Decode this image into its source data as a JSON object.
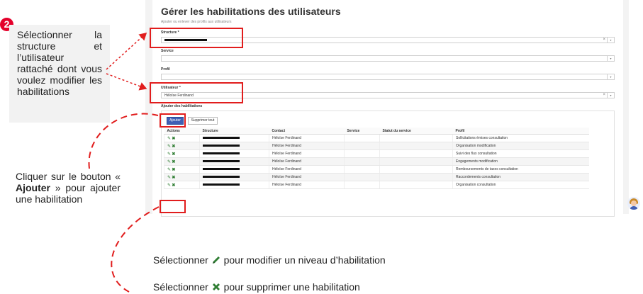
{
  "step_badge": "2",
  "callout_select": "Sélectionner la structure et l’utilisateur rattaché dont vous voulez modifier les habilitations",
  "callout_add_before": "Cliquer sur le bouton « ",
  "callout_add_bold": "Ajouter",
  "callout_add_after": " » pour ajouter une habilitation",
  "legend_edit_before": "Sélectionner",
  "legend_edit_after": "pour modifier un niveau d’habilitation",
  "legend_delete_before": "Sélectionner",
  "legend_delete_after": "pour supprimer une habilitation",
  "form": {
    "title": "Gérer les habilitations des utilisateurs",
    "subtitle": "Ajouter ou enlever des profils aux utilisateurs",
    "structure_label": "Structure *",
    "service_label": "Service",
    "profil_label": "Profil",
    "utilisateur_label": "Utilisateur *",
    "utilisateur_value": "Héloïse Ferdinand",
    "clear_glyph": "×",
    "arrow_glyph": "▾",
    "section_label": "Ajouter des habilitations",
    "add_button": "Ajouter",
    "delete_all_button": "Supprimer tout"
  },
  "table": {
    "headers": [
      "Actions",
      "Structure",
      "Contact",
      "Service",
      "Statut du service",
      "Profil"
    ],
    "edit_glyph": "✎",
    "delete_glyph": "✖",
    "rows": [
      {
        "contact": "Héloïse Ferdinand",
        "service": "",
        "statut": "",
        "profil": "Sollicitations émises consultation"
      },
      {
        "contact": "Héloïse Ferdinand",
        "service": "",
        "statut": "",
        "profil": "Organisation modification"
      },
      {
        "contact": "Héloïse Ferdinand",
        "service": "",
        "statut": "",
        "profil": "Suivi des flux consultation"
      },
      {
        "contact": "Héloïse Ferdinand",
        "service": "",
        "statut": "",
        "profil": "Engagements modification"
      },
      {
        "contact": "Héloïse Ferdinand",
        "service": "",
        "statut": "",
        "profil": "Remboursements de taxes consultation"
      },
      {
        "contact": "Héloïse Ferdinand",
        "service": "",
        "statut": "",
        "profil": "Raccordements consultation"
      },
      {
        "contact": "Héloïse Ferdinand",
        "service": "",
        "statut": "",
        "profil": "Organisation consultation"
      }
    ]
  },
  "colors": {
    "highlight": "#e11d1d",
    "badge": "#e4002b",
    "icon_green": "#2e7d32",
    "button_blue": "#3f5fb5"
  }
}
